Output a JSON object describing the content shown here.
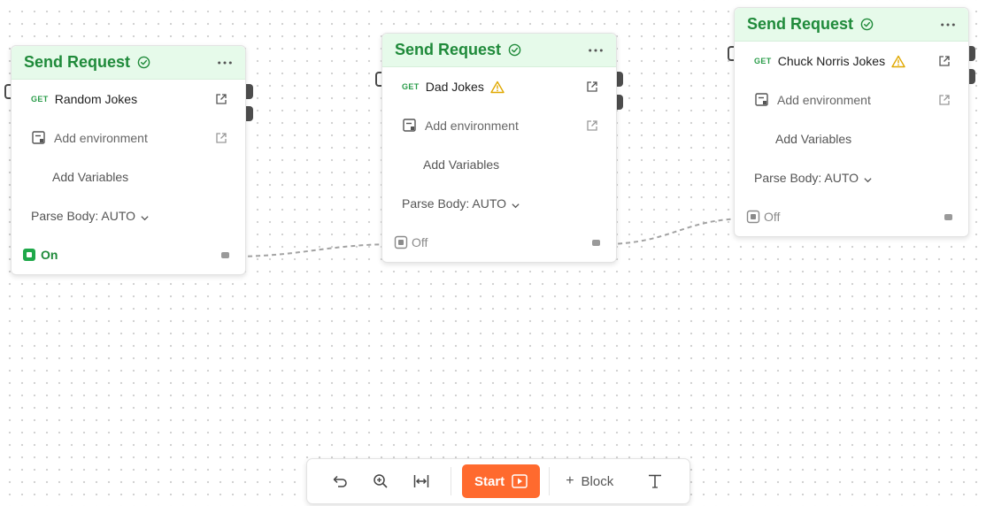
{
  "nodes": [
    {
      "title": "Send Request",
      "method": "GET",
      "request_name": "Random Jokes",
      "has_warning": false,
      "env_label": "Add environment",
      "vars_label": "Add Variables",
      "parse_label": "Parse Body: AUTO",
      "toggle_label": "On",
      "toggle_state": "on"
    },
    {
      "title": "Send Request",
      "method": "GET",
      "request_name": "Dad Jokes",
      "has_warning": true,
      "env_label": "Add environment",
      "vars_label": "Add Variables",
      "parse_label": "Parse Body: AUTO",
      "toggle_label": "Off",
      "toggle_state": "off"
    },
    {
      "title": "Send Request",
      "method": "GET",
      "request_name": "Chuck Norris Jokes",
      "has_warning": true,
      "env_label": "Add environment",
      "vars_label": "Add Variables",
      "parse_label": "Parse Body: AUTO",
      "toggle_label": "Off",
      "toggle_state": "off"
    }
  ],
  "toolbar": {
    "start_label": "Start",
    "block_label": "Block",
    "icons": [
      "undo-icon",
      "zoom-in-icon",
      "fit-width-icon",
      "play-icon",
      "plus-icon",
      "text-tool-icon"
    ]
  },
  "colors": {
    "header_bg": "#e6faea",
    "title_green": "#1f8a3a",
    "method_green": "#2a9c4a",
    "warning": "#e0a800",
    "start_orange": "#ff6a2e",
    "toggle_on": "#1fa84a"
  }
}
